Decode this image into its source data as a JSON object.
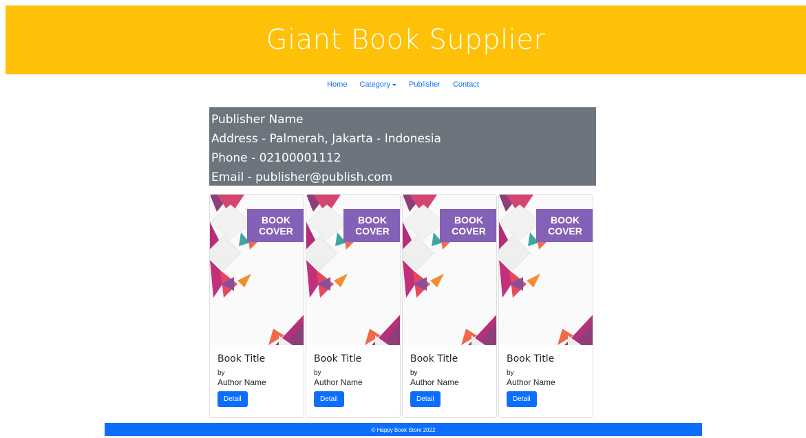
{
  "header": {
    "title": "Giant Book Supplier",
    "bg_color": "#ffc107"
  },
  "nav": {
    "items": [
      {
        "label": "Home"
      },
      {
        "label": "Category"
      },
      {
        "label": "Publisher"
      },
      {
        "label": "Contact"
      }
    ]
  },
  "publisher": {
    "name": "Publisher Name",
    "address": "Address - Palmerah, Jakarta - Indonesia",
    "phone": "Phone - 02100001112",
    "email": "Email - publisher@publish.com",
    "bg_color": "#6c757d"
  },
  "books": [
    {
      "cover_line1": "BOOK",
      "cover_line2": "COVER",
      "title": "Book Title",
      "by": "by",
      "author": "Author Name",
      "button": "Detail"
    },
    {
      "cover_line1": "BOOK",
      "cover_line2": "COVER",
      "title": "Book Title",
      "by": "by",
      "author": "Author Name",
      "button": "Detail"
    },
    {
      "cover_line1": "BOOK",
      "cover_line2": "COVER",
      "title": "Book Title",
      "by": "by",
      "author": "Author Name",
      "button": "Detail"
    },
    {
      "cover_line1": "BOOK",
      "cover_line2": "COVER",
      "title": "Book Title",
      "by": "by",
      "author": "Author Name",
      "button": "Detail"
    }
  ],
  "footer": {
    "text": "© Happy Book Store 2022",
    "bg_color": "#0d6efd"
  }
}
